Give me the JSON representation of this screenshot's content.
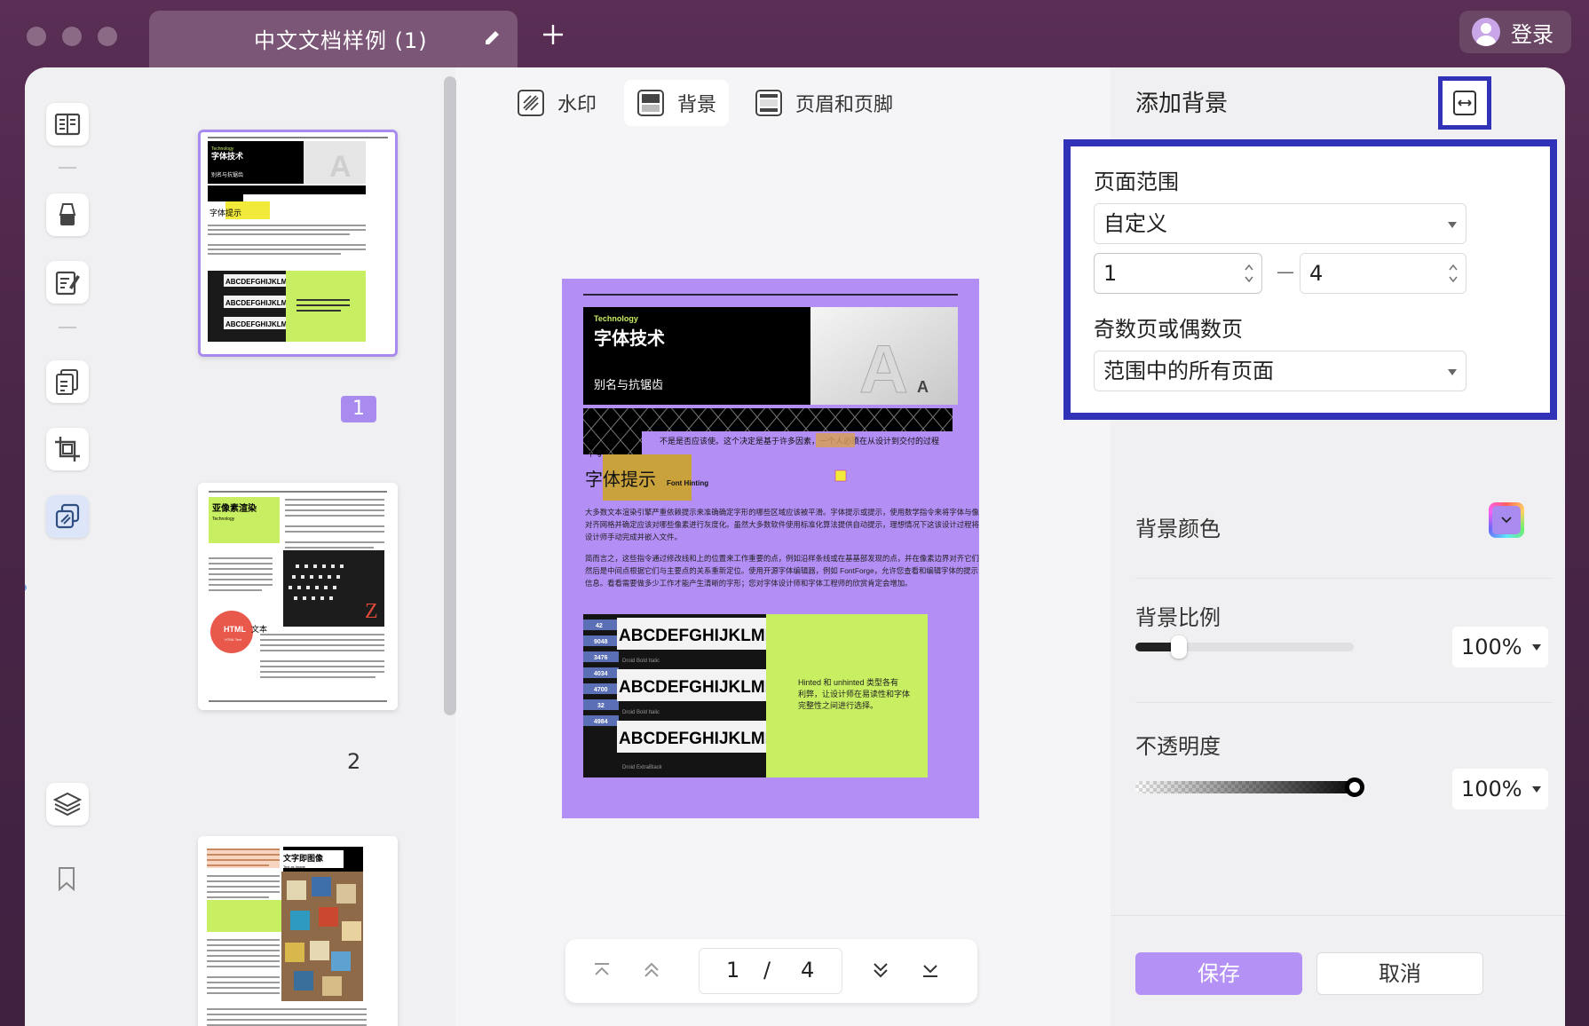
{
  "titlebar": {
    "tab_title": "中文文档样例 (1)",
    "login_label": "登录"
  },
  "toolbar": {
    "watermark_label": "水印",
    "background_label": "背景",
    "header_footer_label": "页眉和页脚"
  },
  "thumbnails": {
    "page1_num": "1",
    "page2_num": "2"
  },
  "preview": {
    "tag": "Technology",
    "title": "字体技术",
    "subtitle": "别名与抗锯齿",
    "para_lead": "不是是否应该使。这个决定是基于许多因素，一个人必须在从设计到交付的过程中考虑。",
    "section_title": "字体提示",
    "section_sub": "Font Hinting",
    "body1": "大多数文本渲染引擎严重依赖提示来准确确定字形的哪些区域应该被平滑。字体提示或提示，使用数学指令来将字体与像素对齐网格并确定应该对哪些像素进行灰度化。虽然大多数软件使用标准化算法提供自动提示，理想情况下这该设计过程将由类型设计师手动完成并嵌入文件。",
    "body2": "简而言之，这些指令通过修改线和上的位置来工作重要的点，例如沿样条线或在基基部发现的点，并在像素边界对齐它们。然后是中间点根据它们与主要点的关系重新定位。使用开源字体编辑器，例如 FontForge，允许您查看和编辑字体的提示信息。看看需要做多少工作才能产生清晰的字形；您对字体设计师和字体工程师的欣赏肯定会增加。",
    "green_text": "Hinted 和 unhinted 类型各有利弊，让设计师在易读性和字体完整性之间进行选择。",
    "abc_line": "ABCDEFGHIJKLMNC",
    "ruler_numbers": [
      "42",
      "9048",
      "3476",
      "4034",
      "4700",
      "32",
      "4984"
    ],
    "ruler_captions": [
      "Droid Bold Italic",
      "Droid Bold Italic",
      "Droid ExtraBlack"
    ],
    "page2_title": "亚像素渲染",
    "page2_sub": "Technology",
    "page2_html": "HTML",
    "page2_html_text": "文本",
    "page2_html_sub": "HTML Text",
    "page3_title": "文字即图像",
    "page3_sub": "Text as Image"
  },
  "pager": {
    "current": "1",
    "separator": "/",
    "total": "4"
  },
  "panel": {
    "title": "添加背景",
    "page_range_label": "页面范围",
    "range_mode": "自定义",
    "range_from": "1",
    "range_dash": "—",
    "range_to": "4",
    "odd_even_label": "奇数页或偶数页",
    "odd_even_value": "范围中的所有页面",
    "bg_color_label": "背景颜色",
    "bg_ratio_label": "背景比例",
    "bg_ratio_value": "100%",
    "opacity_label": "不透明度",
    "opacity_value": "100%",
    "save_label": "保存",
    "cancel_label": "取消"
  },
  "colors": {
    "accent": "#a98bf0",
    "highlight_border": "#3232b8",
    "preview_background": "#b28ef5",
    "green_block": "#c8ef62"
  },
  "slider": {
    "ratio_fraction": 0.2,
    "opacity_fraction": 1.0
  }
}
